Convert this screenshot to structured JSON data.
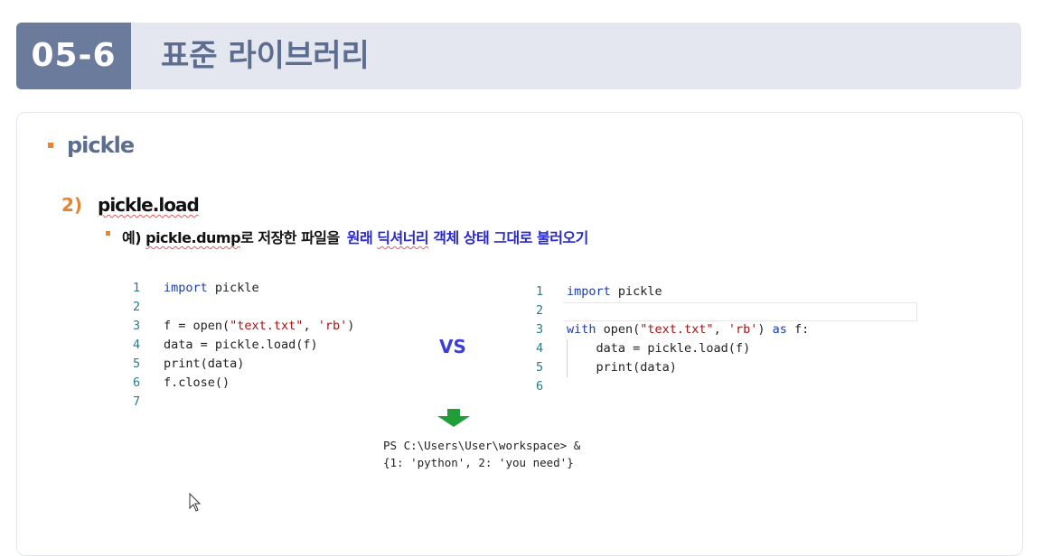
{
  "header": {
    "section_number": "05-6",
    "title": "표준 라이브러리"
  },
  "content": {
    "topic": "pickle",
    "sub_number": "2)",
    "sub_title": "pickle.load",
    "desc_prefix": "예) ",
    "desc_code": "pickle.dump",
    "desc_mid": "로 저장한 파일을",
    "desc_highlight_a": "원래 ",
    "desc_highlight_b": "딕셔너리",
    "desc_highlight_c": " 객체 상태 그대로 불러오기",
    "vs_label": "VS"
  },
  "code_left": [
    {
      "n": "1",
      "parts": [
        [
          "kw",
          "import"
        ],
        [
          "fn",
          " pickle"
        ]
      ]
    },
    {
      "n": "2",
      "parts": []
    },
    {
      "n": "3",
      "parts": [
        [
          "fn",
          "f = open("
        ],
        [
          "str",
          "\"text.txt\""
        ],
        [
          "fn",
          ", "
        ],
        [
          "str",
          "'rb'"
        ],
        [
          "fn",
          ")"
        ]
      ]
    },
    {
      "n": "4",
      "parts": [
        [
          "fn",
          "data = pickle.load(f)"
        ]
      ]
    },
    {
      "n": "5",
      "parts": [
        [
          "fn",
          "print(data)"
        ]
      ]
    },
    {
      "n": "6",
      "parts": [
        [
          "fn",
          "f.close()"
        ]
      ]
    },
    {
      "n": "7",
      "parts": []
    }
  ],
  "code_right": [
    {
      "n": "1",
      "parts": [
        [
          "kw",
          "import"
        ],
        [
          "fn",
          " pickle"
        ]
      ]
    },
    {
      "n": "2",
      "parts": []
    },
    {
      "n": "3",
      "parts": [
        [
          "kw",
          "with"
        ],
        [
          "fn",
          " open("
        ],
        [
          "str",
          "\"text.txt\""
        ],
        [
          "fn",
          ", "
        ],
        [
          "str",
          "'rb'"
        ],
        [
          "fn",
          ") "
        ],
        [
          "kw",
          "as"
        ],
        [
          "fn",
          " f:"
        ]
      ]
    },
    {
      "n": "4",
      "parts": [
        [
          "fn",
          "    data = pickle.load(f)"
        ]
      ]
    },
    {
      "n": "5",
      "parts": [
        [
          "fn",
          "    print(data)"
        ]
      ]
    },
    {
      "n": "6",
      "parts": []
    }
  ],
  "terminal": {
    "line1": "PS C:\\Users\\User\\workspace> &",
    "line2": "{1: 'python', 2: 'you need'}"
  },
  "colors": {
    "badge_bg": "#6b7b9b",
    "header_bg": "#e4e7ef",
    "accent_orange": "#e8842f",
    "highlight_blue": "#2828d0",
    "arrow_green": "#1f9e3a"
  },
  "icons": {
    "arrow": "down-arrow-icon",
    "cursor": "mouse-pointer-icon"
  }
}
